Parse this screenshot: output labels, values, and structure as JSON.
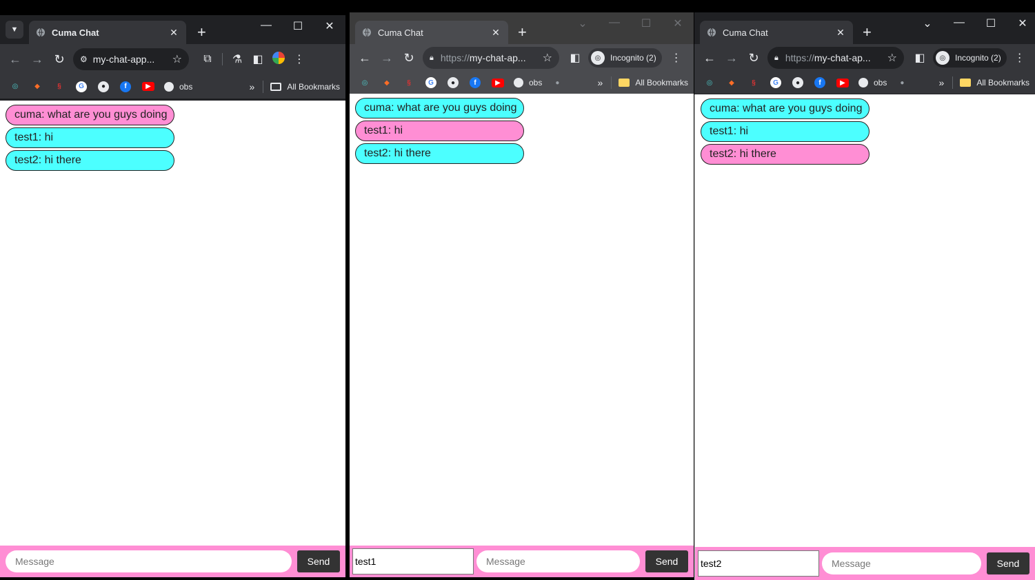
{
  "colors": {
    "pink": "#ff8ed4",
    "cyan": "#4cffff",
    "chrome_dark": "#202124",
    "toolbar": "#35363a",
    "send_button": "#333333"
  },
  "bookmarks": {
    "obs_label": "obs",
    "more_label": "»",
    "all_label": "All Bookmarks"
  },
  "windows": [
    {
      "tab_title": "Cuma Chat",
      "url": "my-chat-app...",
      "incognito_label": "",
      "messages": [
        {
          "text": "cuma: what are you guys doing",
          "color": "pink"
        },
        {
          "text": "test1: hi",
          "color": "cyan"
        },
        {
          "text": "test2: hi there",
          "color": "cyan"
        }
      ],
      "name_value": "",
      "message_placeholder": "Message",
      "send_label": "Send"
    },
    {
      "tab_title": "Cuma Chat",
      "url_scheme": "https://",
      "url": "my-chat-ap...",
      "incognito_label": "Incognito (2)",
      "messages": [
        {
          "text": "cuma: what are you guys doing",
          "color": "cyan"
        },
        {
          "text": "test1: hi",
          "color": "pink"
        },
        {
          "text": "test2: hi there",
          "color": "cyan"
        }
      ],
      "name_value": "test1",
      "message_placeholder": "Message",
      "send_label": "Send"
    },
    {
      "tab_title": "Cuma Chat",
      "url_scheme": "https://",
      "url": "my-chat-ap...",
      "incognito_label": "Incognito (2)",
      "messages": [
        {
          "text": "cuma: what are you guys doing",
          "color": "cyan"
        },
        {
          "text": "test1: hi",
          "color": "cyan"
        },
        {
          "text": "test2: hi there",
          "color": "pink"
        }
      ],
      "name_value": "test2",
      "message_placeholder": "Message",
      "send_label": "Send"
    }
  ]
}
